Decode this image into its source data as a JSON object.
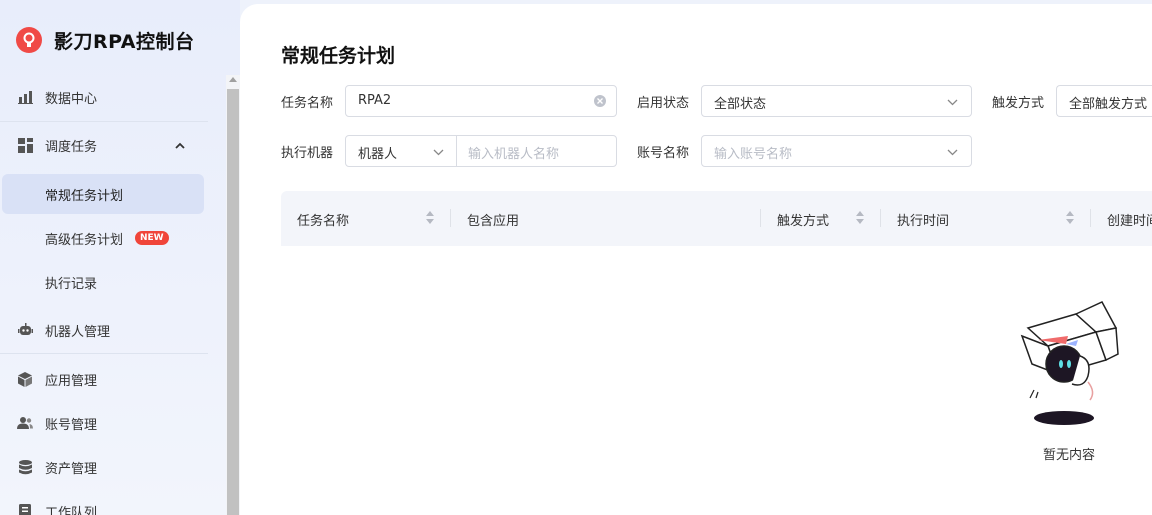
{
  "app": {
    "title": "影刀RPA控制台"
  },
  "sidebar": {
    "items": [
      {
        "label": "数据中心",
        "icon": "bar-chart-icon"
      },
      {
        "label": "调度任务",
        "icon": "grid-icon",
        "expanded": true,
        "children": [
          {
            "label": "常规任务计划",
            "active": true
          },
          {
            "label": "高级任务计划",
            "badge": "NEW"
          },
          {
            "label": "执行记录"
          }
        ]
      },
      {
        "label": "机器人管理",
        "icon": "robot-icon"
      },
      {
        "label": "应用管理",
        "icon": "cube-icon"
      },
      {
        "label": "账号管理",
        "icon": "users-icon"
      },
      {
        "label": "资产管理",
        "icon": "database-icon"
      },
      {
        "label": "工作队列",
        "icon": "queue-icon"
      }
    ]
  },
  "page": {
    "title": "常规任务计划",
    "filters": {
      "task_name": {
        "label": "任务名称",
        "value": "RPA2"
      },
      "status": {
        "label": "启用状态",
        "value": "全部状态"
      },
      "trigger": {
        "label": "触发方式",
        "value": "全部触发方式"
      },
      "machine": {
        "label": "执行机器",
        "type_value": "机器人",
        "placeholder": "输入机器人名称"
      },
      "account": {
        "label": "账号名称",
        "placeholder": "输入账号名称"
      }
    },
    "table": {
      "columns": [
        "任务名称",
        "包含应用",
        "触发方式",
        "执行时间",
        "创建时间"
      ]
    },
    "empty_text": "暂无内容"
  },
  "colors": {
    "accent": "#f04a46",
    "active_bg": "#d9e1f6",
    "badge": "#f0453a"
  }
}
